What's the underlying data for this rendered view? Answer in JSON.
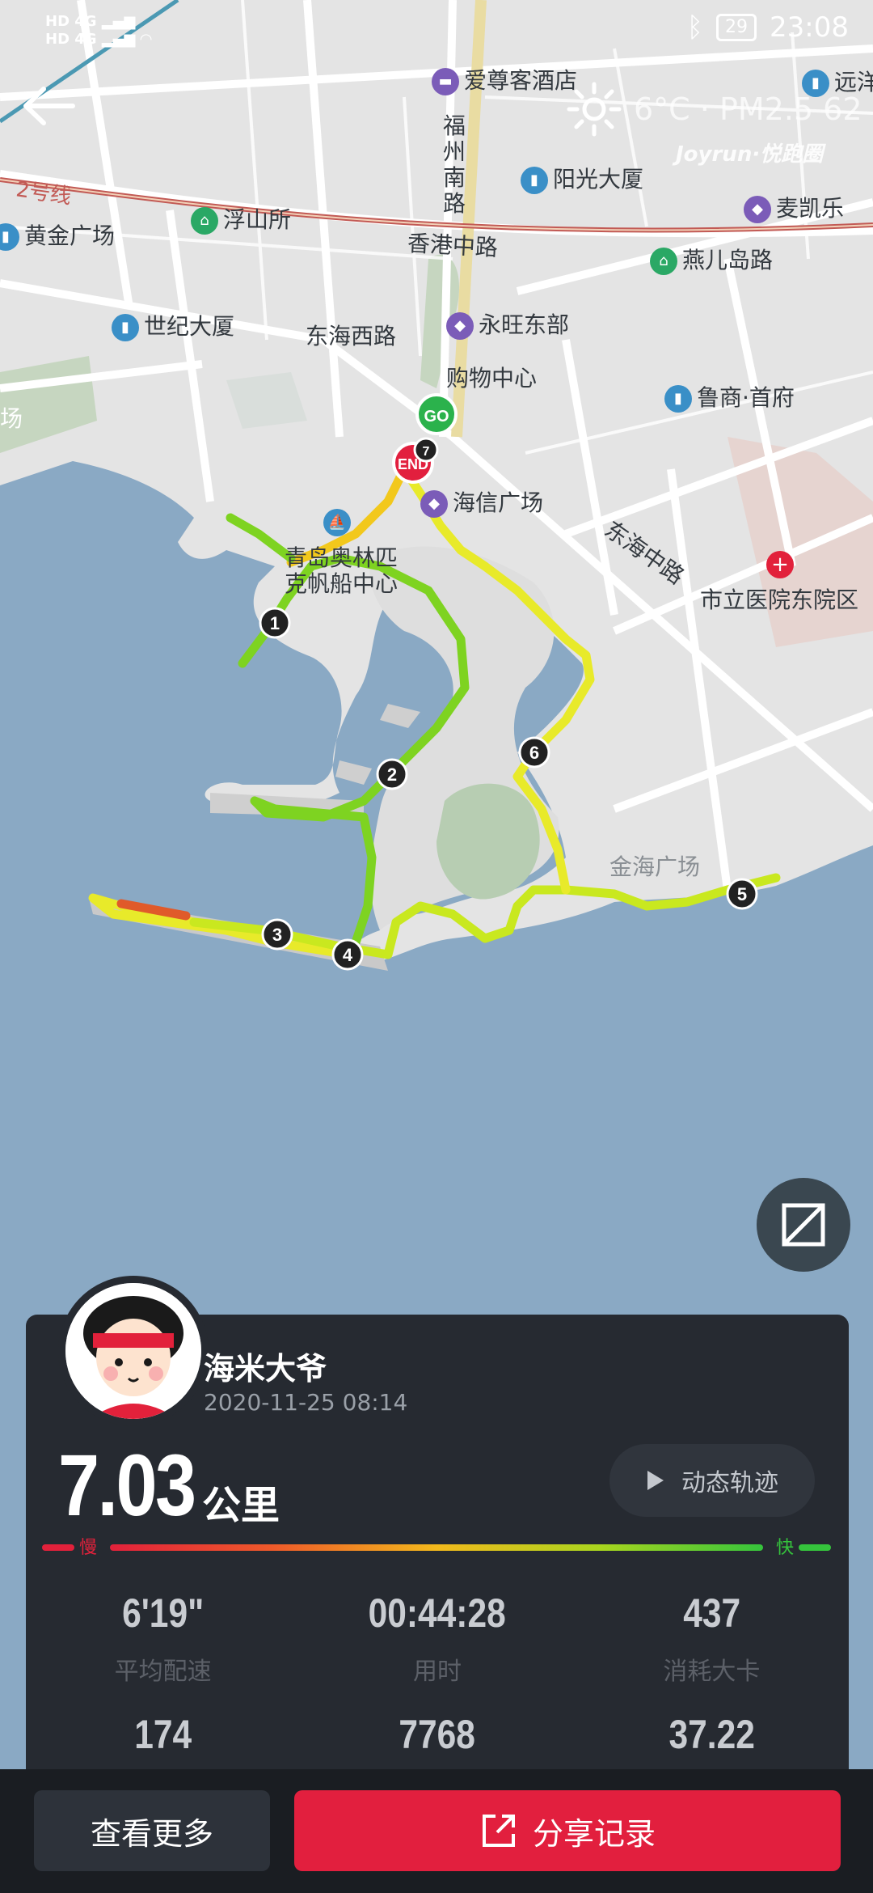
{
  "status_bar": {
    "sim1": "HD 4G",
    "sim2": "HD 4G",
    "battery": "29",
    "time": "23:08"
  },
  "weather": {
    "text": "6°C · PM2.5 62",
    "icon": "sun-icon"
  },
  "brand": "Joyrun·悦跑圈",
  "map": {
    "labels": [
      {
        "key": "hotel",
        "text": "爱尊客酒店",
        "icon": "hotel-icon"
      },
      {
        "key": "yuanyang",
        "text": "远洋公",
        "icon": "building-icon"
      },
      {
        "key": "fuzhou",
        "text": "福州南路"
      },
      {
        "key": "yangguang",
        "text": "阳光大厦",
        "icon": "building-icon"
      },
      {
        "key": "maikaile",
        "text": "麦凯乐",
        "icon": "shopping-icon"
      },
      {
        "key": "line2",
        "text": "2号线"
      },
      {
        "key": "fushansuo",
        "text": "浮山所",
        "icon": "metro-icon"
      },
      {
        "key": "huangjin",
        "text": "黄金广场",
        "icon": "building-icon"
      },
      {
        "key": "xianggang",
        "text": "香港中路"
      },
      {
        "key": "yanerdao",
        "text": "燕儿岛路",
        "icon": "metro-icon"
      },
      {
        "key": "shiji",
        "text": "世纪大厦",
        "icon": "building-icon"
      },
      {
        "key": "donghaixi",
        "text": "东海西路"
      },
      {
        "key": "yongwang1",
        "text": "永旺东部",
        "icon": "shopping-icon"
      },
      {
        "key": "yongwang2",
        "text": "购物中心"
      },
      {
        "key": "luneng",
        "text": "鲁商·首府",
        "icon": "building-icon"
      },
      {
        "key": "chang",
        "text": "场"
      },
      {
        "key": "haixin",
        "text": "海信广场",
        "icon": "shopping-icon"
      },
      {
        "key": "aolinpi1",
        "text": "青岛奥林匹",
        "icon": "boat-icon"
      },
      {
        "key": "aolinpi2",
        "text": "克帆船中心"
      },
      {
        "key": "donghaizhong",
        "text": "东海中路"
      },
      {
        "key": "hospital",
        "text": "市立医院东院区",
        "icon": "hospital-icon"
      },
      {
        "key": "jinhai",
        "text": "金海广场"
      }
    ],
    "start_marker": "GO",
    "end_marker": "END",
    "km_markers": [
      "1",
      "2",
      "3",
      "4",
      "5",
      "6",
      "7"
    ]
  },
  "card": {
    "user_name": "海米大爷",
    "datetime": "2020-11-25 08:14",
    "distance": "7.03",
    "distance_unit": "公里",
    "replay_label": "动态轨迹",
    "pace_slow": "慢",
    "pace_fast": "快",
    "stats": [
      {
        "value": "6'19\"",
        "label": "平均配速"
      },
      {
        "value": "00:44:28",
        "label": "用时"
      },
      {
        "value": "437",
        "label": "消耗大卡"
      },
      {
        "value": "174",
        "label": ""
      },
      {
        "value": "7768",
        "label": ""
      },
      {
        "value": "37.22",
        "label": ""
      }
    ]
  },
  "bottom": {
    "more_label": "查看更多",
    "share_label": "分享记录"
  },
  "colors": {
    "accent": "#e21f3e",
    "card_bg": "#262a31",
    "water": "#8aa9c4",
    "land": "#e4e4e4",
    "route_green": "#7ed321",
    "route_yellow": "#f2e61c"
  }
}
